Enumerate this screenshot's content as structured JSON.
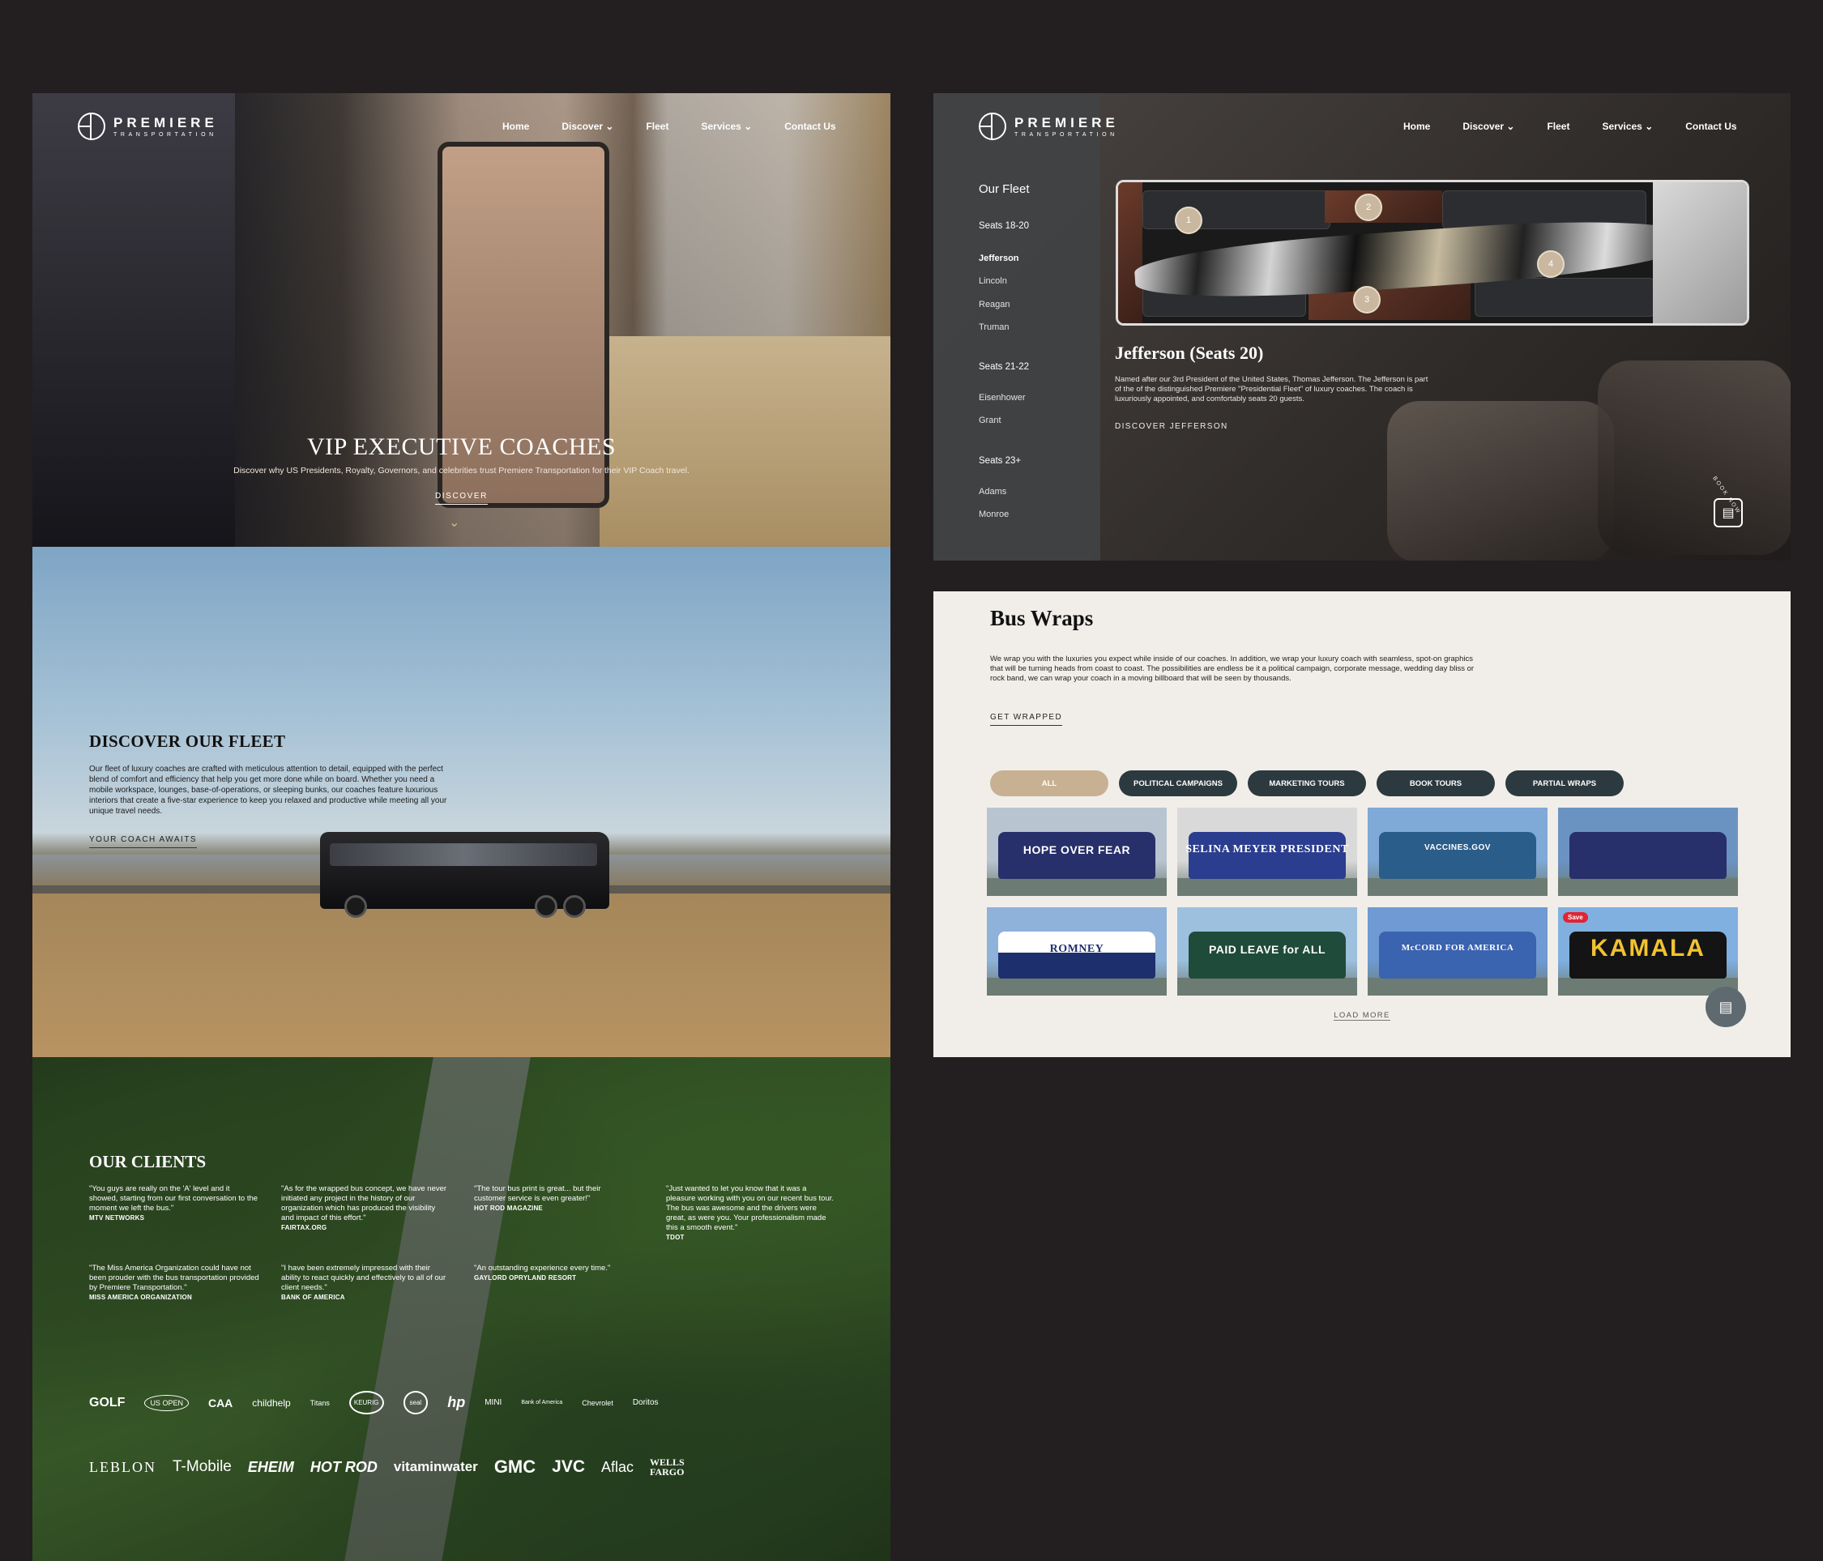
{
  "brand": {
    "name": "PREMIERE",
    "sub": "TRANSPORTATION"
  },
  "nav": {
    "home": "Home",
    "discover": "Discover",
    "fleet": "Fleet",
    "services": "Services",
    "contact": "Contact Us"
  },
  "hero": {
    "title": "VIP EXECUTIVE COACHES",
    "subtitle": "Discover why US Presidents, Royalty, Governors, and celebrities trust Premiere Transportation for their VIP Coach travel.",
    "cta": "DISCOVER"
  },
  "fleet_section": {
    "title": "DISCOVER OUR FLEET",
    "body": "Our fleet of luxury coaches are crafted with meticulous attention to detail, equipped with the perfect blend of comfort and efficiency that help you get more done while on board. Whether you need a mobile workspace, lounges, base-of-operations, or sleeping bunks, our coaches feature luxurious interiors that create a five-star experience to keep you relaxed and productive while meeting all your unique travel needs.",
    "cta": "YOUR COACH AWAITS"
  },
  "clients": {
    "title": "OUR CLIENTS",
    "quotes": [
      {
        "text": "\"You guys are really on the 'A' level and it showed, starting from our first conversation to the moment we left the bus.\"",
        "source": "MTV NETWORKS"
      },
      {
        "text": "\"As for the wrapped bus concept, we have never initiated any project in the history of our organization which has produced the visibility and impact of this effort.\"",
        "source": "FAIRTAX.ORG"
      },
      {
        "text": "\"The tour bus print is great... but their customer service is even greater!\"",
        "source": "HOT ROD MAGAZINE"
      },
      {
        "text": "\"Just wanted to let you know that it was a pleasure working with you on our recent bus tour. The bus was awesome and the drivers were great, as were you. Your professionalism made this a smooth event.\"",
        "source": "TDOT"
      },
      {
        "text": "\"The Miss America Organization could have not been prouder with the bus transportation provided by Premiere Transportation.\"",
        "source": "MISS AMERICA ORGANIZATION"
      },
      {
        "text": "\"I have been extremely impressed with their ability to react quickly and effectively to all of our client needs.\"",
        "source": "BANK OF AMERICA"
      },
      {
        "text": "\"An outstanding experience every time.\"",
        "source": "GAYLORD OPRYLAND RESORT"
      }
    ],
    "logos_row1": [
      "GOLF",
      "US OPEN",
      "CAA",
      "childhelp",
      "Titans",
      "KEURIG",
      "seal",
      "hp",
      "MINI",
      "Bank of America",
      "Chevrolet",
      "Doritos"
    ],
    "logos_row2": [
      "LEBLON",
      "T-Mobile",
      "EHEIM",
      "HOT ROD",
      "vitaminwater",
      "GMC",
      "JVC",
      "Aflac",
      "WELLS FARGO"
    ]
  },
  "detail": {
    "sidebar_title": "Our Fleet",
    "groups": [
      {
        "label": "Seats 18-20",
        "items": [
          "Jefferson",
          "Lincoln",
          "Reagan",
          "Truman"
        ]
      },
      {
        "label": "Seats 21-22",
        "items": [
          "Eisenhower",
          "Grant"
        ]
      },
      {
        "label": "Seats 23+",
        "items": [
          "Adams",
          "Monroe"
        ]
      }
    ],
    "selected": "Jefferson",
    "markers": [
      "1",
      "2",
      "3",
      "4"
    ],
    "title": "Jefferson (Seats 20)",
    "body": "Named after our 3rd President of the United States, Thomas Jefferson. The Jefferson is part of the of the distinguished Premiere \"Presidential Fleet\" of luxury coaches. The coach is luxuriously appointed, and comfortably seats 20 guests.",
    "cta": "DISCOVER JEFFERSON",
    "book": "BOOK NOW"
  },
  "wraps": {
    "title": "Bus Wraps",
    "body": "We wrap you with the luxuries you expect while inside of our coaches. In addition, we wrap your luxury coach with seamless, spot-on graphics that will be turning heads from coast to coast. The possibilities are endless be it a political campaign, corporate message, wedding day bliss or rock band, we can wrap your coach in a moving billboard that will be seen by thousands.",
    "cta": "GET WRAPPED",
    "filters": [
      "ALL",
      "POLITICAL CAMPAIGNS",
      "MARKETING TOURS",
      "BOOK TOURS",
      "PARTIAL WRAPS"
    ],
    "thumbs": [
      {
        "caption": "HOPE OVER FEAR",
        "color": "#27306a",
        "sky": "#b8c4d0"
      },
      {
        "caption": "SELINA MEYER PRESIDENT",
        "color": "#2a3d8e",
        "sky": "#d9d9d9"
      },
      {
        "caption": "VACCINES.GOV",
        "color": "#2b5d8a",
        "sky": "#7fa9d6"
      },
      {
        "caption": "",
        "color": "#27306a",
        "sky": "#6b93c2"
      },
      {
        "caption": "ROMNEY",
        "color": "#1e2f6e",
        "sky": "#8eb2d9"
      },
      {
        "caption": "PAID LEAVE for ALL",
        "color": "#1f4b3a",
        "sky": "#9cc0de"
      },
      {
        "caption": "McCORD FOR AMERICA",
        "color": "#3a63b0",
        "sky": "#6f9ad3"
      },
      {
        "caption": "KAMALA",
        "color": "#141414",
        "sky": "#7fb0e0"
      }
    ],
    "save_label": "Save",
    "load_more": "LOAD MORE"
  }
}
